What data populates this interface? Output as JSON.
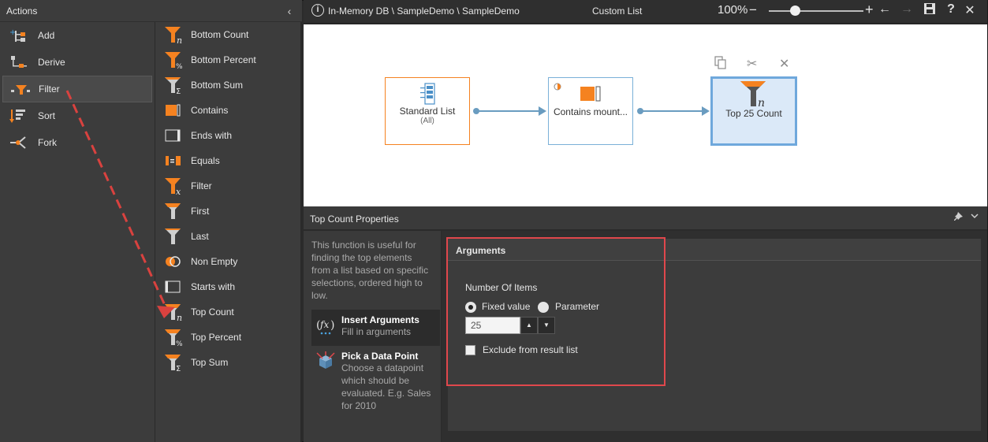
{
  "actions": {
    "title": "Actions",
    "categories": [
      {
        "label": "Add",
        "icon": "add-icon"
      },
      {
        "label": "Derive",
        "icon": "derive-icon"
      },
      {
        "label": "Filter",
        "icon": "filter-icon",
        "selected": true
      },
      {
        "label": "Sort",
        "icon": "sort-icon"
      },
      {
        "label": "Fork",
        "icon": "fork-icon"
      }
    ],
    "functions": [
      {
        "label": "Bottom Count",
        "icon": "funnel-n-icon"
      },
      {
        "label": "Bottom Percent",
        "icon": "funnel-percent-icon"
      },
      {
        "label": "Bottom Sum",
        "icon": "funnel-sigma-icon"
      },
      {
        "label": "Contains",
        "icon": "contains-icon"
      },
      {
        "label": "Ends with",
        "icon": "ends-with-icon"
      },
      {
        "label": "Equals",
        "icon": "equals-icon"
      },
      {
        "label": "Filter",
        "icon": "funnel-x-icon"
      },
      {
        "label": "First",
        "icon": "funnel-icon"
      },
      {
        "label": "Last",
        "icon": "funnel-gray-icon"
      },
      {
        "label": "Non Empty",
        "icon": "non-empty-icon"
      },
      {
        "label": "Starts with",
        "icon": "starts-with-icon"
      },
      {
        "label": "Top Count",
        "icon": "funnel-n-icon"
      },
      {
        "label": "Top Percent",
        "icon": "funnel-percent-icon"
      },
      {
        "label": "Top Sum",
        "icon": "funnel-sigma-icon"
      }
    ]
  },
  "topbar": {
    "path": "In-Memory DB \\ SampleDemo \\ SampleDemo",
    "view_title": "Custom List",
    "zoom": "100%"
  },
  "canvas": {
    "nodes": [
      {
        "title": "Standard List",
        "subtitle": "(All)"
      },
      {
        "title": "Contains mount...",
        "subtitle": ""
      },
      {
        "title": "Top 25 Count",
        "subtitle": ""
      }
    ]
  },
  "properties": {
    "title": "Top Count Properties",
    "description": "This function is useful for finding the top elements from a list based on specific selections, ordered high to low.",
    "steps": [
      {
        "title": "Insert Arguments",
        "subtitle": "Fill in arguments"
      },
      {
        "title": "Pick a Data Point",
        "subtitle": "Choose a datapoint which should be evaluated. E.g. Sales for 2010"
      }
    ],
    "arguments": {
      "header": "Arguments",
      "number_label": "Number Of Items",
      "fixed_label": "Fixed value",
      "param_label": "Parameter",
      "value": "25",
      "exclude_label": "Exclude from result list"
    }
  },
  "colors": {
    "accent_orange": "#f58220",
    "connector_blue": "#6a9cc0",
    "highlight_red": "#e0474c"
  }
}
